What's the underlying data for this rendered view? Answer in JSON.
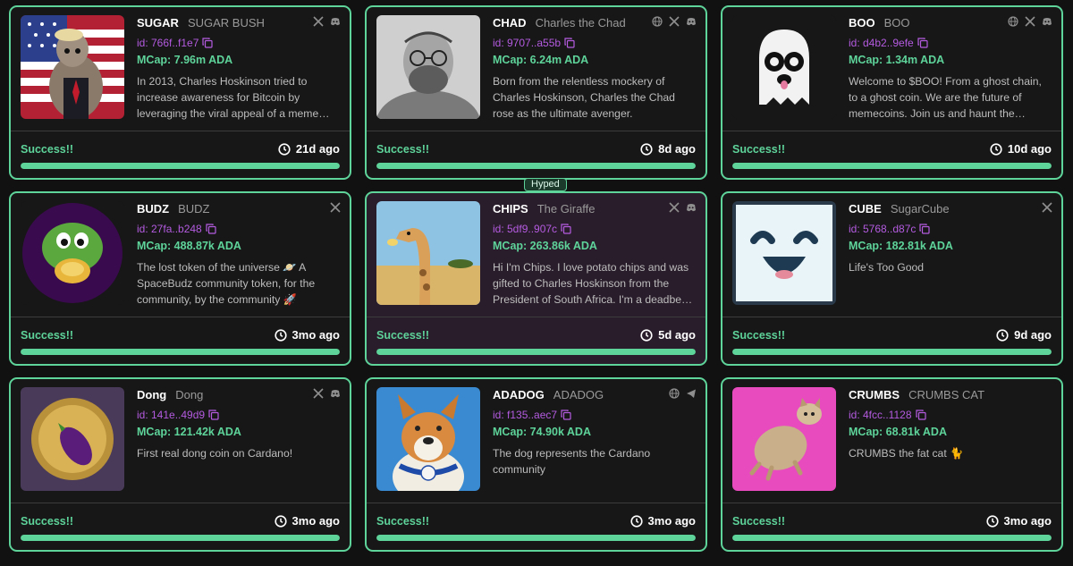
{
  "colors": {
    "accent": "#5ed39a",
    "id_color": "#b45be0",
    "background": "#111111",
    "hyped_card": "#2a1d2b"
  },
  "badge": {
    "hyped_label": "Hyped"
  },
  "cards": [
    {
      "ticker": "SUGAR",
      "name": "SUGAR BUSH",
      "id": "id: 766f..f1e7",
      "mcap": "MCap: 7.96m ADA",
      "description": "In 2013, Charles Hoskinson tried to increase awareness for Bitcoin by leveraging the viral appeal of a meme…",
      "status": "Success!!",
      "age": "21d ago",
      "progress": 1.0,
      "socials": [
        "x-icon",
        "discord-icon"
      ]
    },
    {
      "ticker": "CHAD",
      "name": "Charles the Chad",
      "id": "id: 9707..a55b",
      "mcap": "MCap: 6.24m ADA",
      "description": "Born from the relentless mockery of Charles Hoskinson, Charles the Chad rose as the ultimate avenger.",
      "status": "Success!!",
      "age": "8d ago",
      "progress": 1.0,
      "socials": [
        "globe-icon",
        "x-icon",
        "discord-icon"
      ]
    },
    {
      "ticker": "BOO",
      "name": "BOO",
      "id": "id: d4b2..9efe",
      "mcap": "MCap: 1.34m ADA",
      "description": "Welcome to $BOO! From a ghost chain, to a ghost coin. We are the future of memecoins. Join us and haunt the…",
      "status": "Success!!",
      "age": "10d ago",
      "progress": 1.0,
      "socials": [
        "globe-icon",
        "x-icon",
        "discord-icon"
      ]
    },
    {
      "ticker": "BUDZ",
      "name": "BUDZ",
      "id": "id: 27fa..b248",
      "mcap": "MCap: 488.87k ADA",
      "description": "The lost token of the universe 🪐 A SpaceBudz community token, for the community, by the community 🚀",
      "status": "Success!!",
      "age": "3mo ago",
      "progress": 1.0,
      "socials": [
        "x-icon"
      ]
    },
    {
      "ticker": "CHIPS",
      "name": "The Giraffe",
      "id": "id: 5df9..907c",
      "mcap": "MCap: 263.86k ADA",
      "description": "Hi I'm Chips. I love potato chips and was gifted to Charles Hoskinson from the President of South Africa. I'm a deadbe…",
      "status": "Success!!",
      "age": "5d ago",
      "progress": 1.0,
      "socials": [
        "x-icon",
        "discord-icon"
      ]
    },
    {
      "ticker": "CUBE",
      "name": "SugarCube",
      "id": "id: 5768..d87c",
      "mcap": "MCap: 182.81k ADA",
      "description": "Life's Too Good",
      "status": "Success!!",
      "age": "9d ago",
      "progress": 1.0,
      "socials": [
        "x-icon"
      ]
    },
    {
      "ticker": "Dong",
      "name": "Dong",
      "id": "id: 141e..49d9",
      "mcap": "MCap: 121.42k ADA",
      "description": "First real dong coin on Cardano!",
      "status": "Success!!",
      "age": "3mo ago",
      "progress": 1.0,
      "socials": [
        "x-icon",
        "discord-icon"
      ]
    },
    {
      "ticker": "ADADOG",
      "name": "ADADOG",
      "id": "id: f135..aec7",
      "mcap": "MCap: 74.90k ADA",
      "description": "The dog represents the Cardano community",
      "status": "Success!!",
      "age": "3mo ago",
      "progress": 1.0,
      "socials": [
        "globe-icon",
        "telegram-icon"
      ]
    },
    {
      "ticker": "CRUMBS",
      "name": "CRUMBS CAT",
      "id": "id: 4fcc..1128",
      "mcap": "MCap: 68.81k ADA",
      "description": "CRUMBS the fat cat 🐈",
      "status": "Success!!",
      "age": "3mo ago",
      "progress": 1.0,
      "socials": []
    }
  ]
}
